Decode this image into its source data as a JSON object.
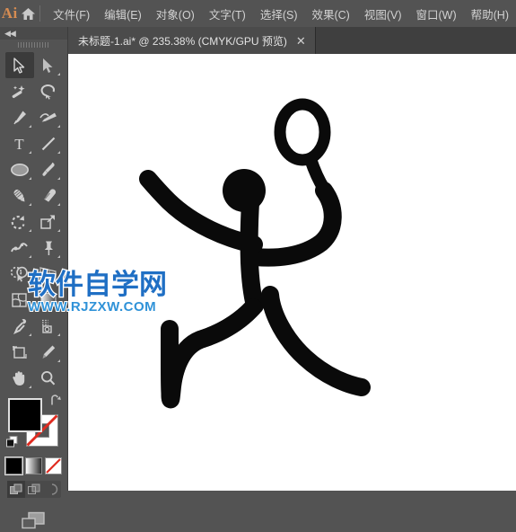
{
  "app": {
    "name": "Ai",
    "logo_color": "#d68c52",
    "home_icon": "home-icon"
  },
  "menubar": {
    "items": [
      {
        "label": "文件(F)",
        "name": "menu-file"
      },
      {
        "label": "编辑(E)",
        "name": "menu-edit"
      },
      {
        "label": "对象(O)",
        "name": "menu-object"
      },
      {
        "label": "文字(T)",
        "name": "menu-type"
      },
      {
        "label": "选择(S)",
        "name": "menu-select"
      },
      {
        "label": "效果(C)",
        "name": "menu-effect"
      },
      {
        "label": "视图(V)",
        "name": "menu-view"
      },
      {
        "label": "窗口(W)",
        "name": "menu-window"
      },
      {
        "label": "帮助(H)",
        "name": "menu-help"
      }
    ]
  },
  "tabbar": {
    "tab_title": "未标题-1.ai* @ 235.38% (CMYK/GPU 预览)",
    "close_label": "✕",
    "document_name": "未标题-1.ai",
    "modified": "*",
    "zoom_level": "235.38%",
    "color_mode": "CMYK/GPU 预览"
  },
  "toolpanel": {
    "collapse_label": "◀◀",
    "tools": [
      {
        "label": "选择工具",
        "icon": "selection-arrow-icon",
        "active": true,
        "flyout": false
      },
      {
        "label": "直接选择工具",
        "icon": "direct-selection-arrow-icon",
        "active": false,
        "flyout": true
      },
      {
        "label": "魔棒工具",
        "icon": "magic-wand-icon",
        "active": false,
        "flyout": false
      },
      {
        "label": "套索工具",
        "icon": "lasso-icon",
        "active": false,
        "flyout": false
      },
      {
        "label": "钢笔工具",
        "icon": "pen-icon",
        "active": false,
        "flyout": true
      },
      {
        "label": "曲率工具",
        "icon": "curvature-icon",
        "active": false,
        "flyout": false
      },
      {
        "label": "文字工具",
        "icon": "type-icon",
        "active": false,
        "flyout": true
      },
      {
        "label": "直线段工具",
        "icon": "line-segment-icon",
        "active": false,
        "flyout": true
      },
      {
        "label": "矩形工具",
        "icon": "ellipse-icon",
        "active": false,
        "flyout": true
      },
      {
        "label": "画笔工具",
        "icon": "paintbrush-icon",
        "active": false,
        "flyout": true
      },
      {
        "label": "斑点画笔工具",
        "icon": "blob-brush-icon",
        "active": false,
        "flyout": false
      },
      {
        "label": "橡皮擦工具",
        "icon": "eraser-icon",
        "active": false,
        "flyout": true
      },
      {
        "label": "旋转工具",
        "icon": "rotate-icon",
        "active": false,
        "flyout": true
      },
      {
        "label": "比例缩放工具",
        "icon": "scale-icon",
        "active": false,
        "flyout": true
      },
      {
        "label": "宽度工具",
        "icon": "width-warp-icon",
        "active": false,
        "flyout": true
      },
      {
        "label": "操控变形工具",
        "icon": "puppet-warp-pin-icon",
        "active": false,
        "flyout": false
      },
      {
        "label": "形状生成器工具",
        "icon": "shape-builder-icon",
        "active": false,
        "flyout": true
      },
      {
        "label": "透视网格工具",
        "icon": "perspective-grid-icon",
        "active": false,
        "flyout": true
      },
      {
        "label": "网格工具",
        "icon": "mesh-icon",
        "active": false,
        "flyout": false
      },
      {
        "label": "渐变工具",
        "icon": "gradient-icon",
        "active": false,
        "flyout": false
      },
      {
        "label": "吸管工具",
        "icon": "eyedropper-icon",
        "active": false,
        "flyout": true
      },
      {
        "label": "混合工具",
        "icon": "blend-icon",
        "active": false,
        "flyout": false
      },
      {
        "label": "符号喷枪工具",
        "icon": "symbol-sprayer-icon",
        "active": false,
        "flyout": true
      },
      {
        "label": "柱形图工具",
        "icon": "column-graph-icon",
        "active": false,
        "flyout": true
      },
      {
        "label": "画板工具",
        "icon": "artboard-icon",
        "active": false,
        "flyout": false
      },
      {
        "label": "切片工具",
        "icon": "slice-knife-icon",
        "active": false,
        "flyout": true
      },
      {
        "label": "抓手工具",
        "icon": "hand-icon",
        "active": false,
        "flyout": true
      },
      {
        "label": "缩放工具",
        "icon": "zoom-magnifier-icon",
        "active": false,
        "flyout": false
      }
    ],
    "fill": {
      "label": "填色",
      "color": "#000000"
    },
    "stroke": {
      "label": "描边",
      "color": "none"
    },
    "swap_label": "互换填色和描边",
    "default_label": "默认填色和描边",
    "color_modes": [
      {
        "label": "颜色",
        "icon": "solid-color-icon",
        "selected": true
      },
      {
        "label": "渐变",
        "icon": "gradient-swatch-icon",
        "selected": false
      },
      {
        "label": "无",
        "icon": "none-swatch-icon",
        "selected": false
      }
    ],
    "draw_modes": [
      {
        "label": "正常绘图",
        "icon": "draw-normal-icon",
        "selected": true
      },
      {
        "label": "背面绘图",
        "icon": "draw-behind-icon",
        "selected": false
      },
      {
        "label": "内部绘图",
        "icon": "draw-inside-icon",
        "selected": false
      }
    ],
    "screen_mode": {
      "label": "更改屏幕模式",
      "icon": "screen-mode-icon"
    }
  },
  "canvas": {
    "background": "#ffffff",
    "artwork_name": "stick-figure-drawing",
    "artwork_color": "#000000",
    "artwork_description": "黑色简笔人物（跑步/投掷姿势）"
  },
  "watermark": {
    "line1": "软件自学网",
    "line2": "WWW.RJZXW.COM",
    "color1": "#1f6fc4",
    "color2": "#2f92d8"
  }
}
